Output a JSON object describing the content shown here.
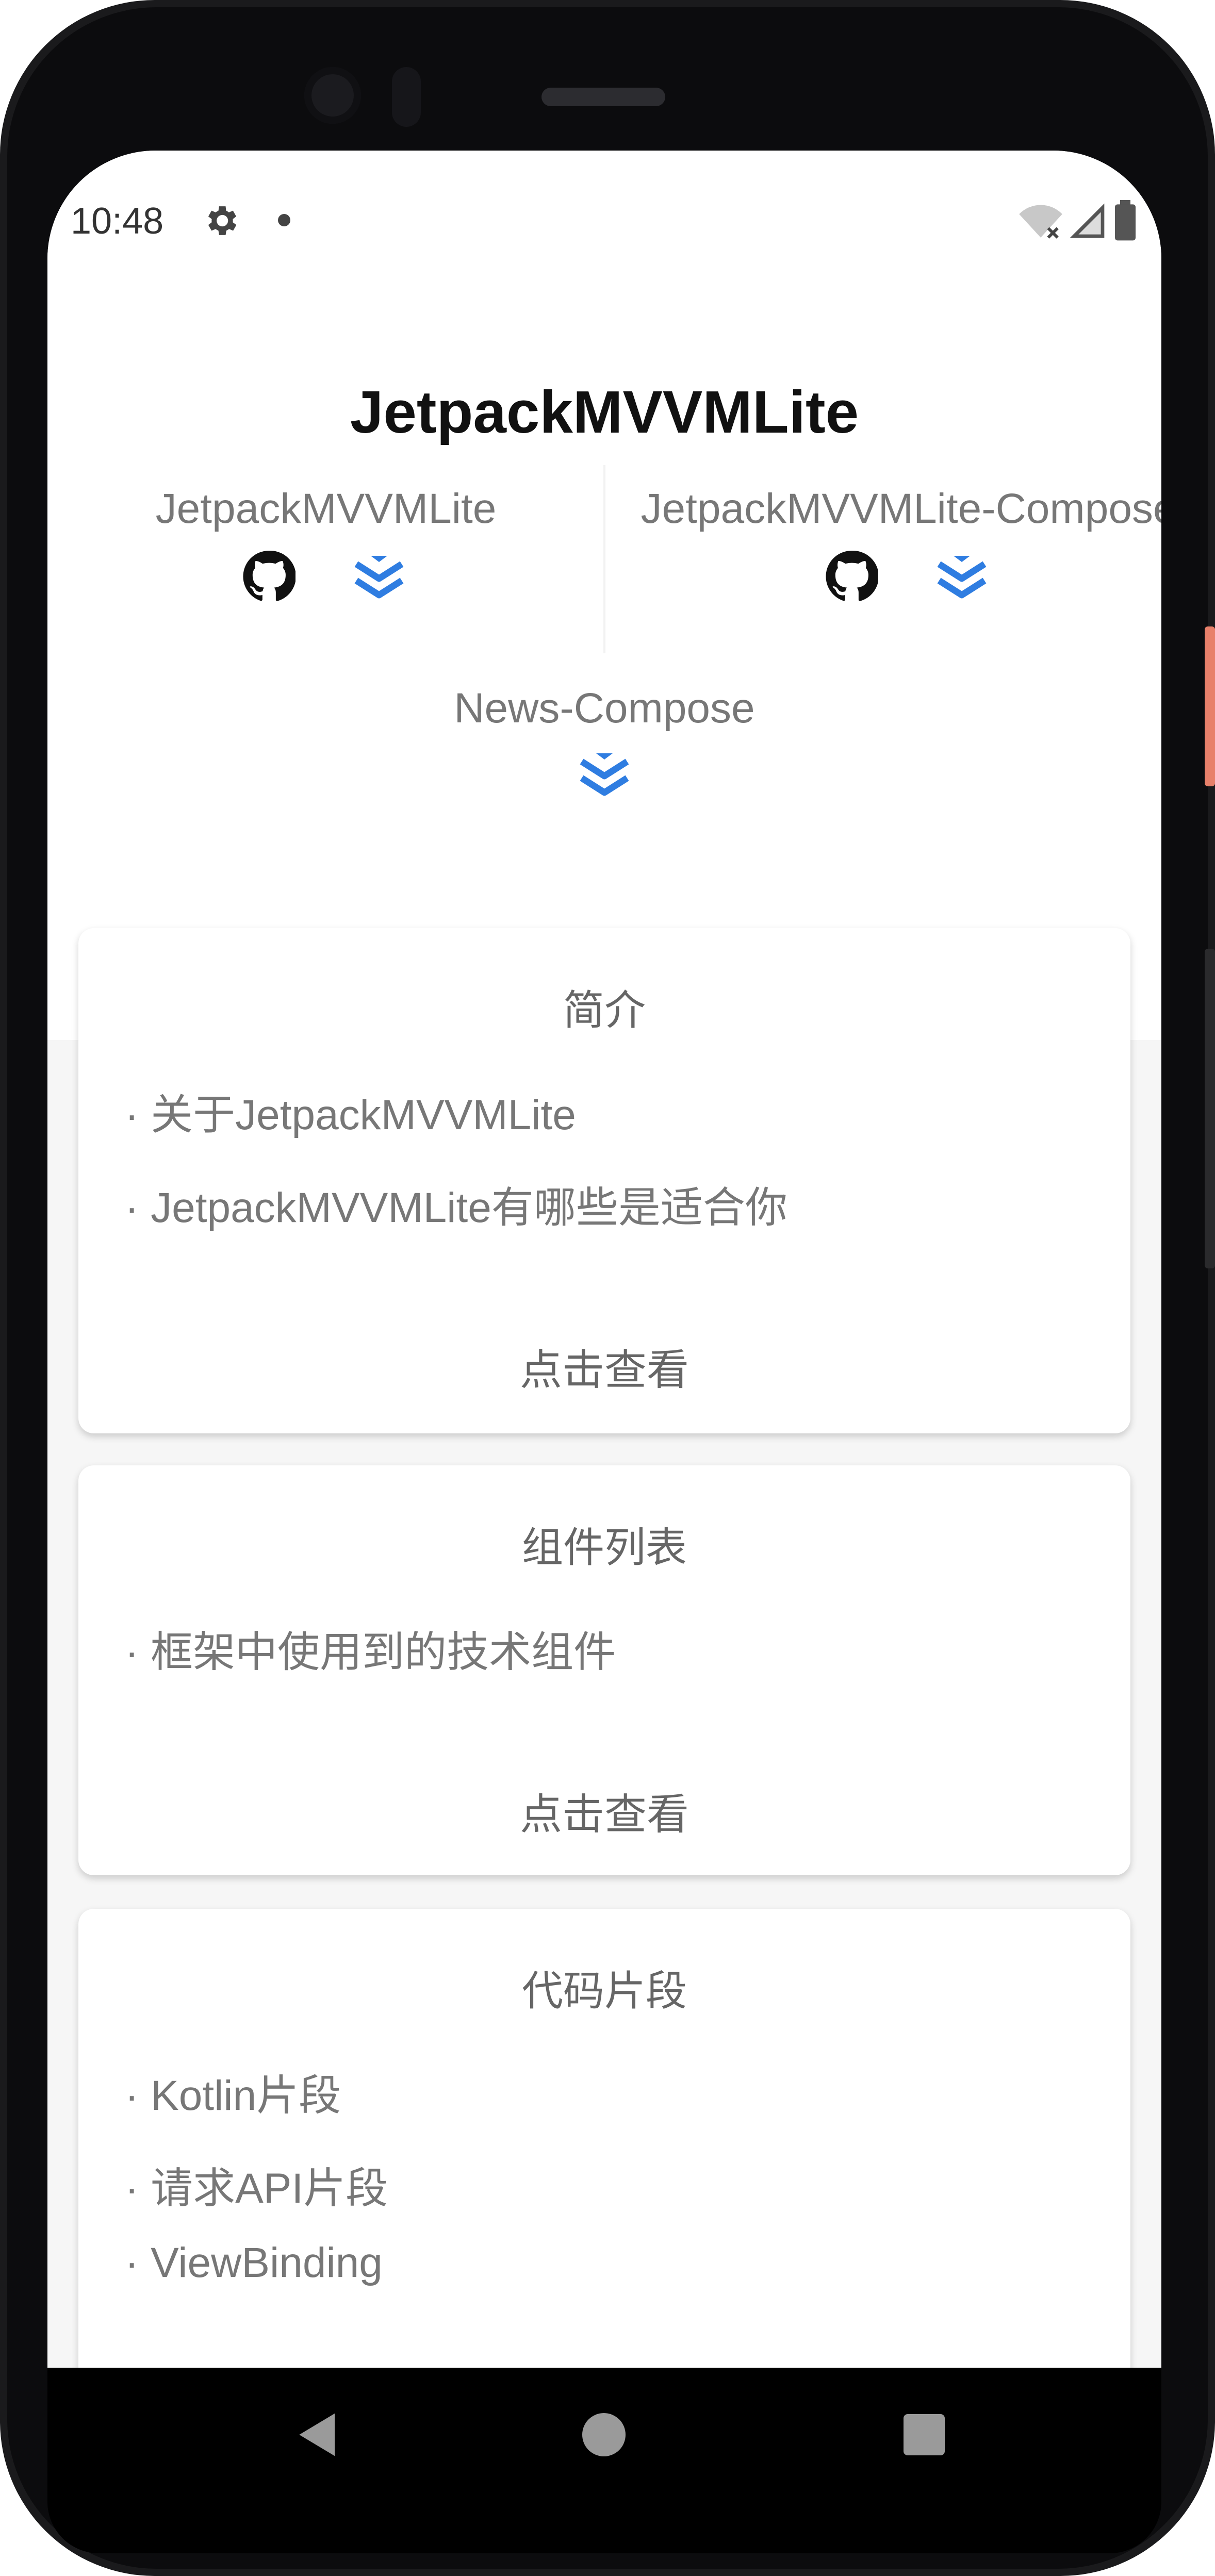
{
  "status_bar": {
    "time": "10:48",
    "icons": [
      "gear-icon",
      "notification-dot-icon",
      "wifi-off-icon",
      "signal-icon",
      "battery-icon"
    ]
  },
  "app": {
    "title": "JetpackMVVMLite"
  },
  "projects": [
    {
      "name": "JetpackMVVMLite",
      "icons": [
        "github-icon",
        "download-icon"
      ]
    },
    {
      "name": "JetpackMVVMLite-Compose",
      "icons": [
        "github-icon",
        "download-icon"
      ]
    },
    {
      "name": "News-Compose",
      "icons": [
        "download-icon"
      ]
    }
  ],
  "cards": [
    {
      "title": "简介",
      "items": [
        "· 关于JetpackMVVMLite",
        "· JetpackMVVMLite有哪些是适合你"
      ],
      "link": "点击查看"
    },
    {
      "title": "组件列表",
      "items": [
        "· 框架中使用到的技术组件"
      ],
      "link": "点击查看"
    },
    {
      "title": "代码片段",
      "items": [
        "· Kotlin片段",
        "· 请求API片段",
        "· ViewBinding"
      ]
    }
  ],
  "colors": {
    "accent": "#2f7de1",
    "text_secondary": "#777777",
    "background": "#f6f6f6"
  },
  "nav_bar": {
    "buttons": [
      "back-icon",
      "home-icon",
      "recents-icon"
    ]
  }
}
